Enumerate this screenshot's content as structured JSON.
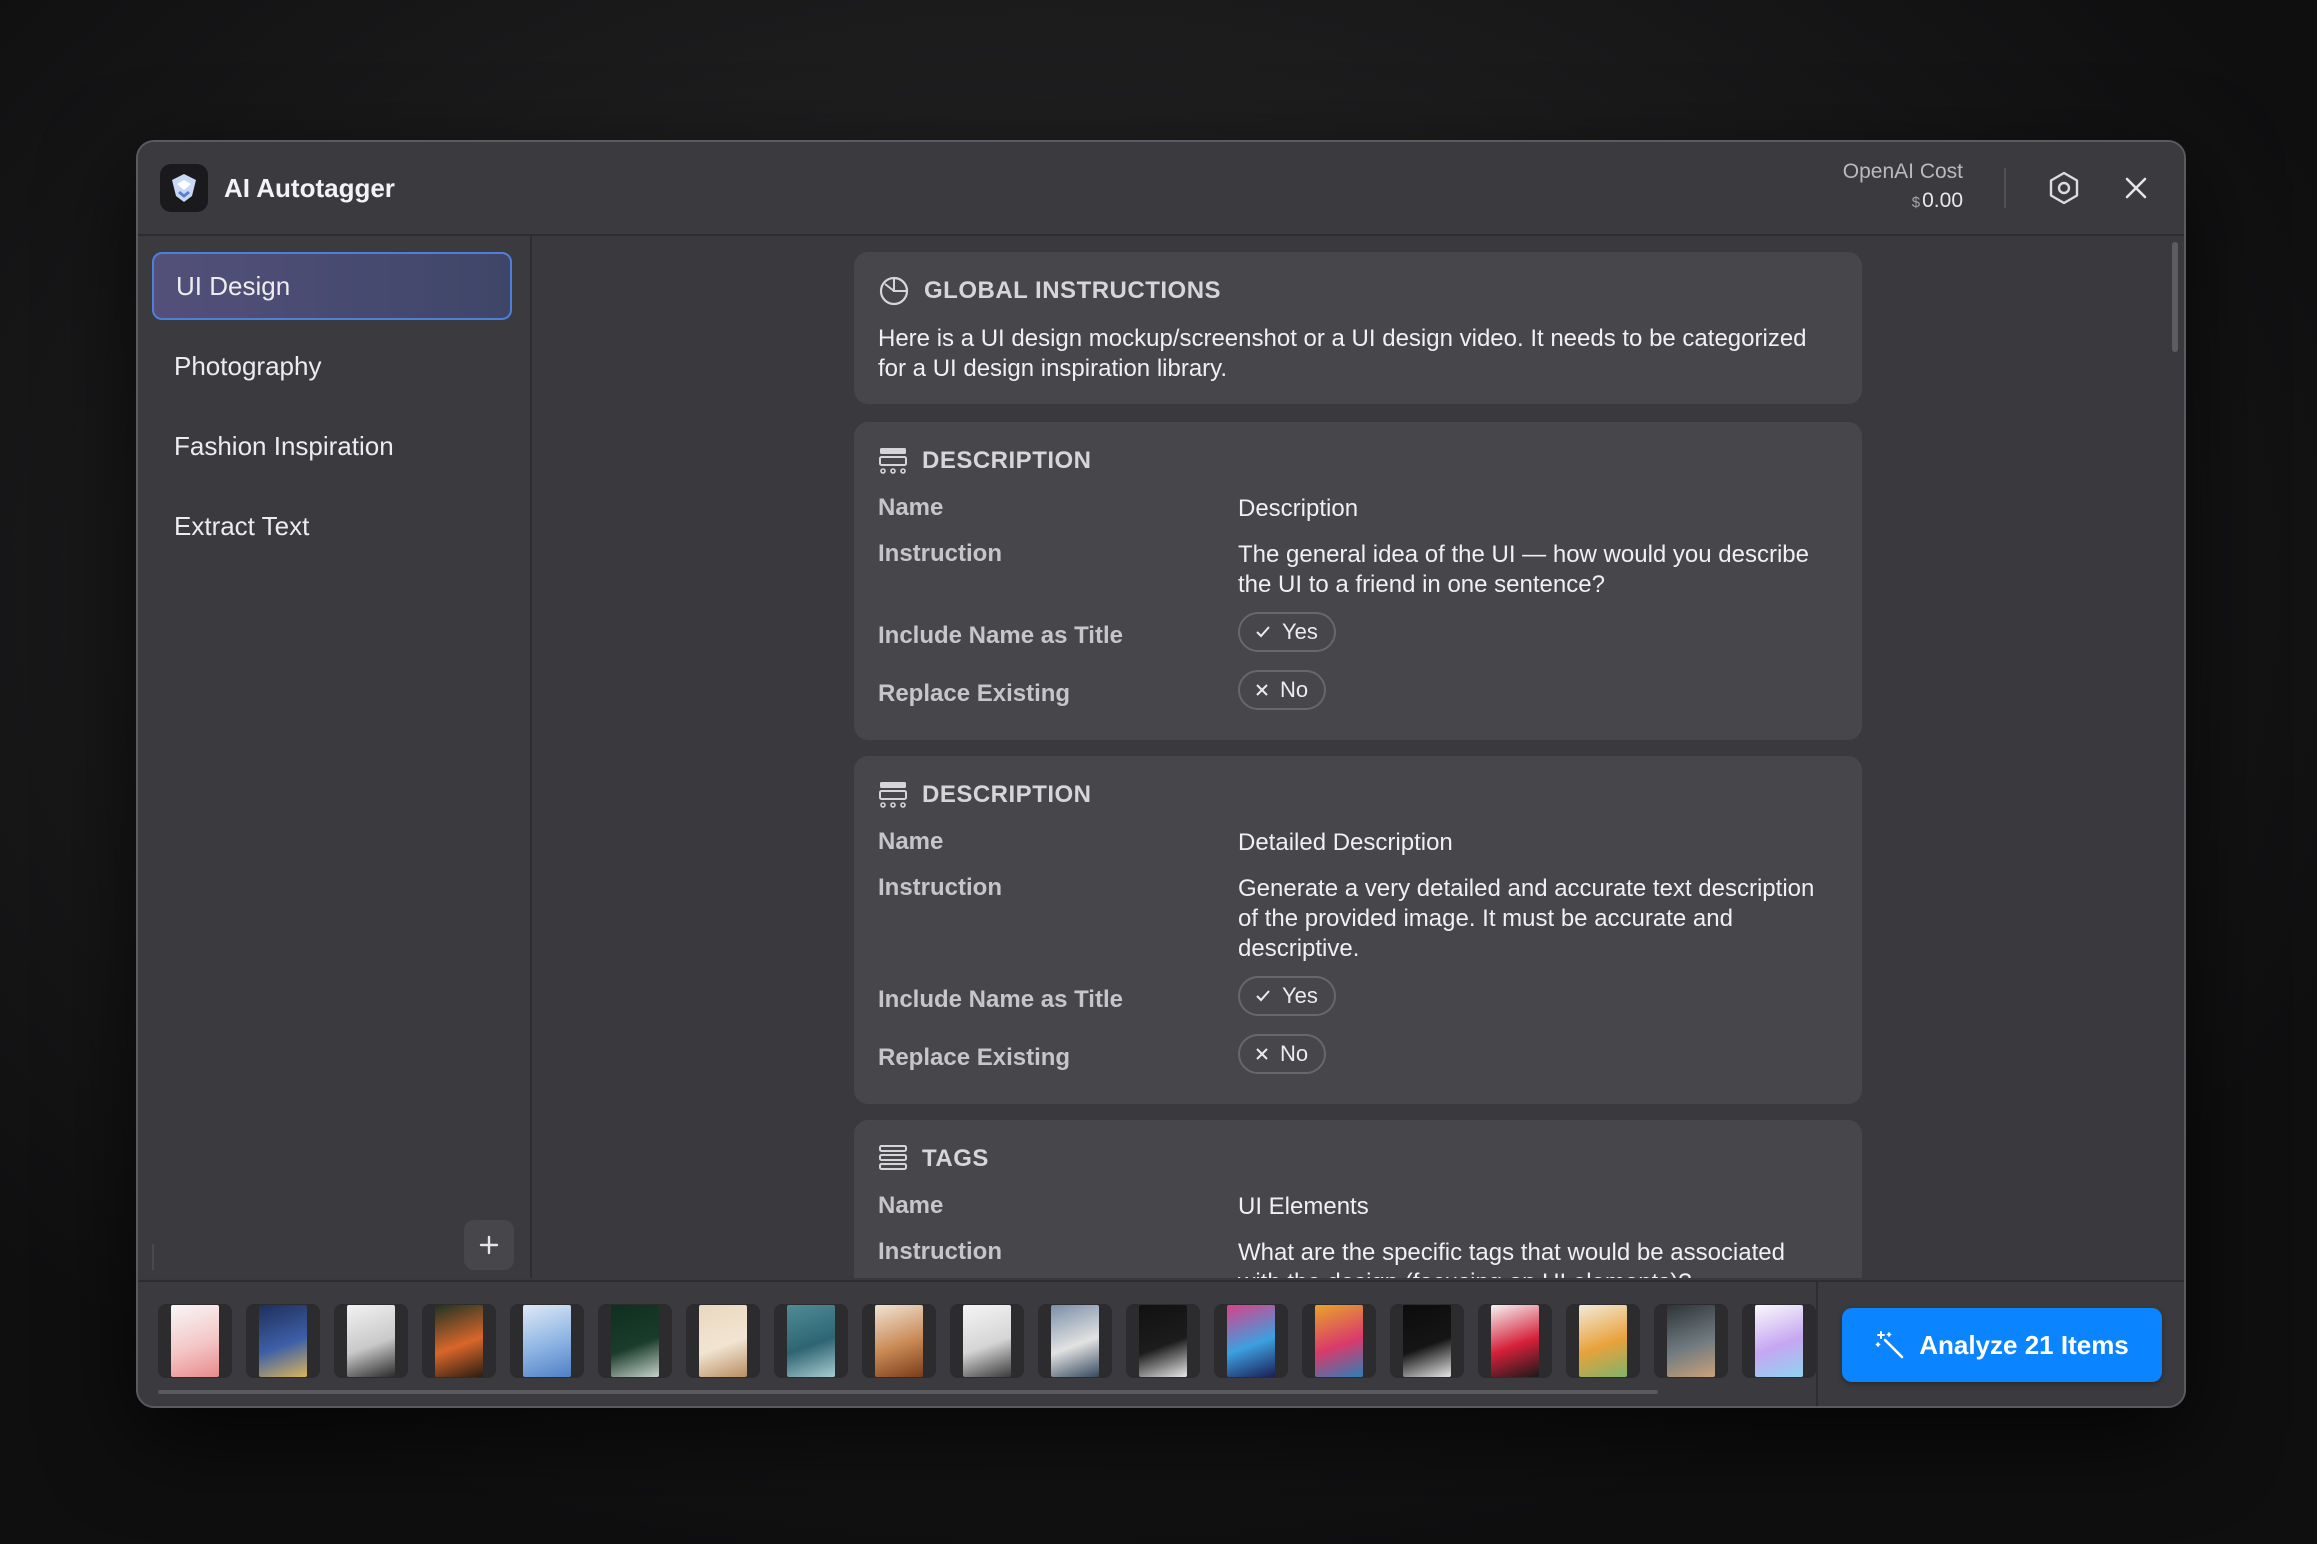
{
  "app": {
    "title": "AI Autotagger"
  },
  "header": {
    "cost_label": "OpenAI Cost",
    "cost_currency": "$",
    "cost_value": "0.00"
  },
  "sidebar": {
    "items": [
      {
        "label": "UI Design",
        "active": true
      },
      {
        "label": "Photography",
        "active": false
      },
      {
        "label": "Fashion Inspiration",
        "active": false
      },
      {
        "label": "Extract Text",
        "active": false
      }
    ]
  },
  "global": {
    "title": "GLOBAL INSTRUCTIONS",
    "text": "Here is a UI design mockup/screenshot or a UI design video. It needs to be categorized for a UI design inspiration library."
  },
  "labels": {
    "name": "Name",
    "instruction": "Instruction",
    "include_title": "Include Name as Title",
    "replace_existing": "Replace Existing"
  },
  "cards": [
    {
      "type": "DESCRIPTION",
      "name": "Description",
      "instruction": "The general idea of the UI — how would you describe the UI to a friend in one sentence?",
      "include_title": "Yes",
      "replace_existing": "No"
    },
    {
      "type": "DESCRIPTION",
      "name": "Detailed Description",
      "instruction": "Generate a very detailed and accurate text description of the provided image. It must be accurate and descriptive.",
      "include_title": "Yes",
      "replace_existing": "No"
    },
    {
      "type": "TAGS",
      "name": "UI Elements",
      "instruction": "What are the specific tags that would be associated with the design (focusing on UI elements)?"
    }
  ],
  "thumbnails": [
    {
      "colors": [
        "#f7f7f7",
        "#f4c7c7",
        "#e88a8a"
      ]
    },
    {
      "colors": [
        "#1f2f5a",
        "#3d5fa8",
        "#d9b55a"
      ]
    },
    {
      "colors": [
        "#f2f2f2",
        "#c9c9c9",
        "#2a2a2a"
      ]
    },
    {
      "colors": [
        "#1e3324",
        "#d9662a",
        "#2a1d12"
      ]
    },
    {
      "colors": [
        "#dfe9f5",
        "#8db4e4",
        "#4f7fc5"
      ]
    },
    {
      "colors": [
        "#0f2f20",
        "#1a3c2a",
        "#c7d2cc"
      ]
    },
    {
      "colors": [
        "#ead8bf",
        "#f1e5d2",
        "#b98d62"
      ]
    },
    {
      "colors": [
        "#4e8c96",
        "#2f6572",
        "#a8ccd2"
      ]
    },
    {
      "colors": [
        "#f1e3d6",
        "#c98a55",
        "#7a3c1a"
      ]
    },
    {
      "colors": [
        "#f5f5f5",
        "#d5d5d5",
        "#3a3a3a"
      ]
    },
    {
      "colors": [
        "#7a8fa8",
        "#e2e2e2",
        "#34495e"
      ]
    },
    {
      "colors": [
        "#111111",
        "#1c1c1c",
        "#e8e8e8"
      ]
    },
    {
      "colors": [
        "#d8428a",
        "#3da0e0",
        "#1a1e55"
      ]
    },
    {
      "colors": [
        "#e8a42a",
        "#d93a6b",
        "#2c7fb8"
      ]
    },
    {
      "colors": [
        "#0c0c0c",
        "#151515",
        "#e6e6e6"
      ]
    },
    {
      "colors": [
        "#f4f4f4",
        "#d6203a",
        "#1a1a1a"
      ]
    },
    {
      "colors": [
        "#f2eadc",
        "#e9a23b",
        "#7fb36b"
      ]
    },
    {
      "colors": [
        "#2e3437",
        "#6f7a80",
        "#c9a27a"
      ]
    },
    {
      "colors": [
        "#fafafa",
        "#c6a6f2",
        "#8fd3f0"
      ]
    }
  ],
  "analyze": {
    "label": "Analyze 21 Items"
  }
}
